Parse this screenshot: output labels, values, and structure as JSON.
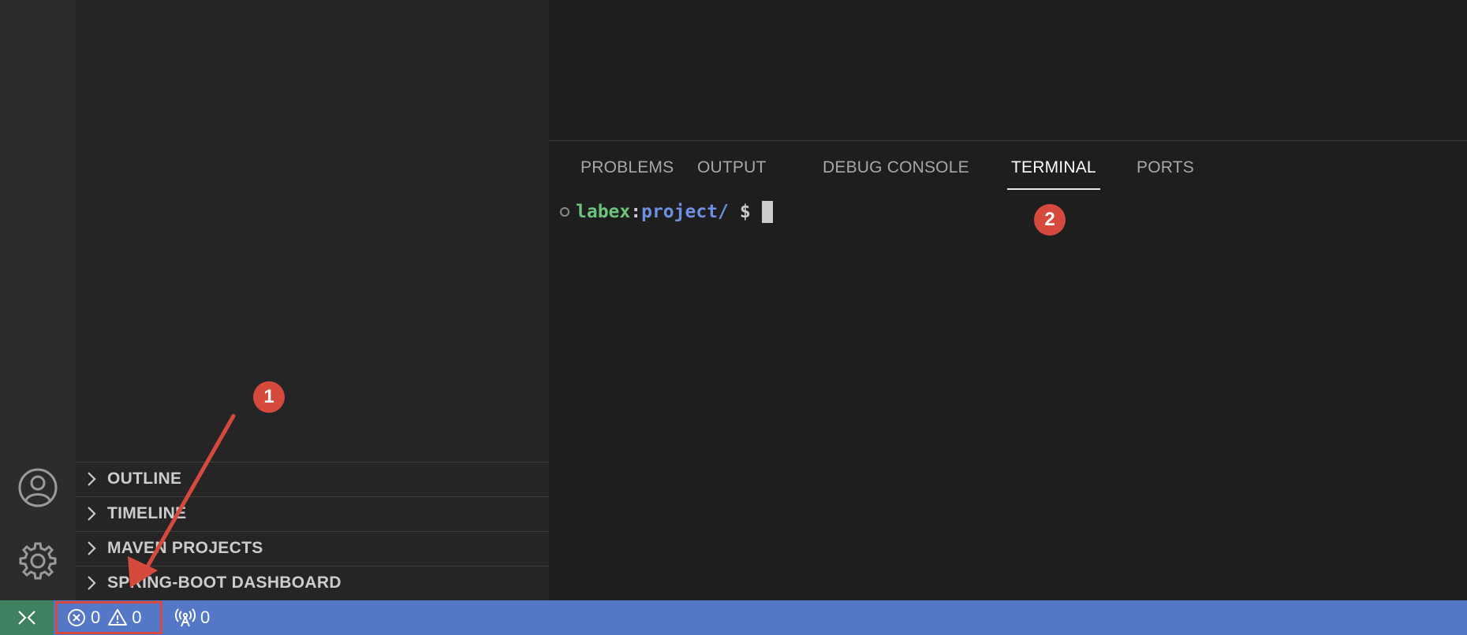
{
  "sidebar": {
    "sections": [
      {
        "label": "OUTLINE"
      },
      {
        "label": "TIMELINE"
      },
      {
        "label": "MAVEN PROJECTS"
      },
      {
        "label": "SPRING-BOOT DASHBOARD"
      }
    ]
  },
  "activity_bar": {
    "icons": [
      "account-icon",
      "gear-icon"
    ]
  },
  "panel": {
    "tabs": [
      {
        "label": "PROBLEMS",
        "active": false
      },
      {
        "label": "OUTPUT",
        "active": false
      },
      {
        "label": "DEBUG CONSOLE",
        "active": false
      },
      {
        "label": "TERMINAL",
        "active": true
      },
      {
        "label": "PORTS",
        "active": false
      }
    ],
    "terminal": {
      "user": "labex",
      "separator": ":",
      "path": "project/",
      "prompt_symbol": "$"
    }
  },
  "status_bar": {
    "errors": "0",
    "warnings": "0",
    "ports": "0"
  },
  "annotations": {
    "badge_1": "1",
    "badge_2": "2"
  },
  "colors": {
    "status_bar": "#5577c8",
    "remote": "#3d8160",
    "annotation": "#d64a3e",
    "terminal_user": "#6cc37c",
    "terminal_path": "#6f8fe0"
  }
}
